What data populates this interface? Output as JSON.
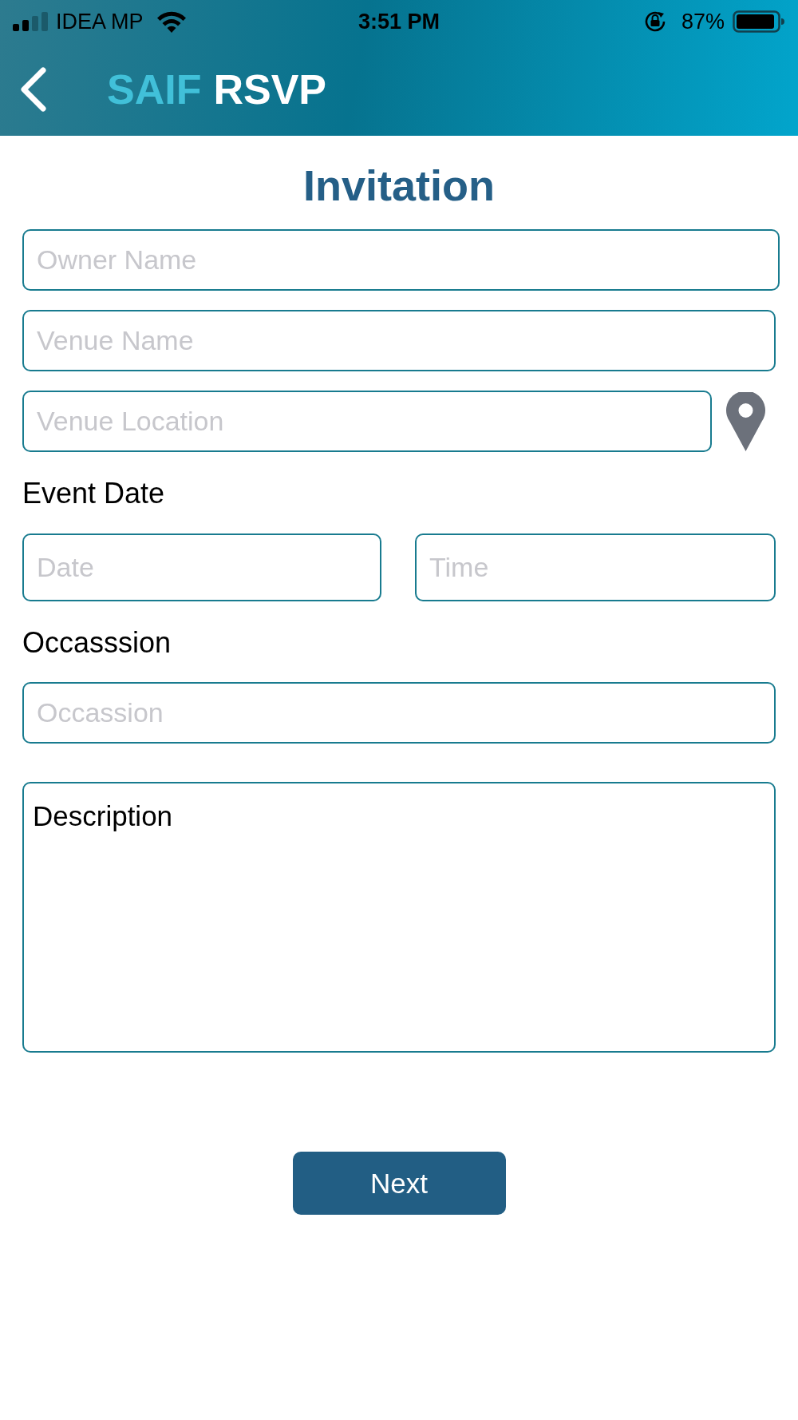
{
  "status_bar": {
    "carrier": "IDEA MP",
    "time": "3:51 PM",
    "battery": "87%"
  },
  "header": {
    "brand": "SAIF",
    "title": "RSVP"
  },
  "form": {
    "heading": "Invitation",
    "owner_name": {
      "placeholder": "Owner Name"
    },
    "venue_name": {
      "placeholder": "Venue Name"
    },
    "venue_location": {
      "placeholder": "Venue Location"
    },
    "event_date_label": "Event Date",
    "date": {
      "placeholder": "Date"
    },
    "time": {
      "placeholder": "Time"
    },
    "occasion_label": "Occasssion",
    "occasion": {
      "placeholder": "Occassion"
    },
    "description": {
      "value": "Description"
    },
    "next_button": "Next"
  }
}
